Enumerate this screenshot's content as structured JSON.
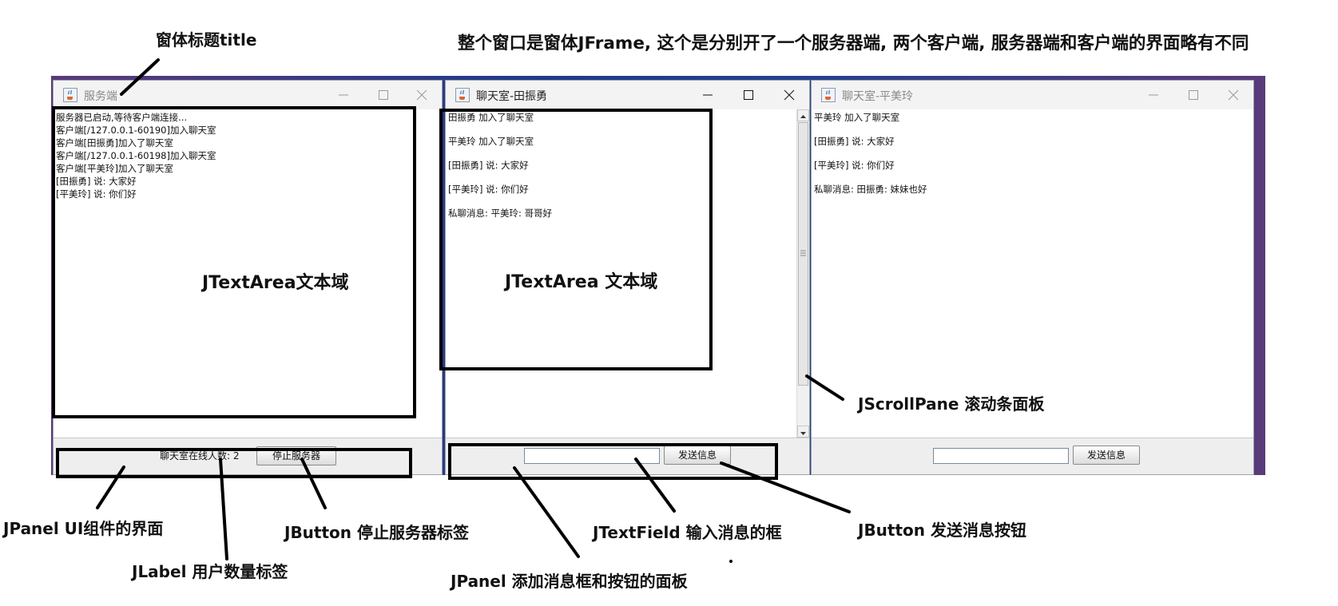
{
  "annotations": {
    "window_title": "窗体标题title",
    "overview": "整个窗口是窗体JFrame, 这个是分别开了一个服务器端, 两个客户端, 服务器端和客户端的界面略有不同",
    "textarea_server": "JTextArea文本域",
    "textarea_client": "JTextArea 文本域",
    "scrollpane": "JScrollPane 滚动条面板",
    "jpanel_ui": "JPanel UI组件的界面",
    "jlabel_count": "JLabel 用户数量标签",
    "jbutton_stop": "JButton 停止服务器标签",
    "jtextfield": "JTextField 输入消息的框",
    "jbutton_send": "JButton 发送消息按钮",
    "jpanel_message": "JPanel 添加消息框和按钮的面板"
  },
  "server_window": {
    "title": "服务端",
    "log": [
      "服务器已启动,等待客户端连接...",
      "客户端[/127.0.0.1-60190]加入聊天室",
      "客户端[田振勇]加入了聊天室",
      "客户端[/127.0.0.1-60198]加入聊天室",
      "客户端[平美玲]加入了聊天室",
      "[田振勇] 说: 大家好",
      "[平美玲] 说: 你们好"
    ],
    "online_label": "聊天室在线人数: 2",
    "stop_button": "停止服务器"
  },
  "client1_window": {
    "title": "聊天室-田振勇",
    "messages": [
      "田振勇 加入了聊天室",
      "平美玲 加入了聊天室",
      "[田振勇] 说: 大家好",
      "[平美玲] 说: 你们好",
      "私聊消息: 平美玲: 哥哥好"
    ],
    "message_input": "",
    "send_button": "发送信息"
  },
  "client2_window": {
    "title": "聊天室-平美玲",
    "messages": [
      "平美玲 加入了聊天室",
      "[田振勇] 说: 大家好",
      "[平美玲] 说: 你们好",
      "私聊消息: 田振勇: 妹妹也好"
    ],
    "message_input": "",
    "send_button": "发送信息"
  },
  "icons": [
    "java-app-icon",
    "minimize-icon",
    "maximize-icon",
    "close-icon",
    "scroll-up-icon",
    "scroll-down-icon"
  ],
  "colors": {
    "highlight_box": "#000000",
    "titlebar": "#f3f3f3",
    "panel": "#eeeeee"
  }
}
